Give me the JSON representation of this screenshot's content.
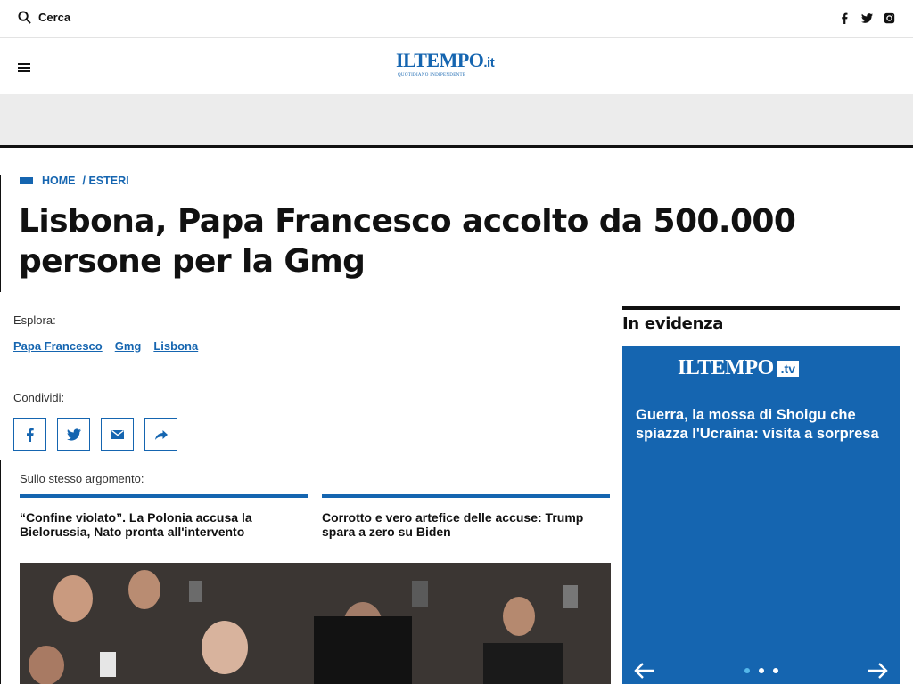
{
  "topbar": {
    "search_label": "Cerca",
    "social": [
      "facebook-icon",
      "twitter-icon",
      "instagram-icon"
    ]
  },
  "header": {
    "logo_main": "ILTEMPO",
    "logo_suffix": ".it",
    "logo_tagline": "Quotidiano Indipendente"
  },
  "breadcrumb": {
    "home": "HOME",
    "section": "/ ESTERI"
  },
  "article": {
    "title": "Lisbona, Papa Francesco accolto da 500.000 persone per la Gmg"
  },
  "explore": {
    "label": "Esplora:",
    "tags": [
      "Papa Francesco",
      "Gmg",
      "Lisbona"
    ]
  },
  "share": {
    "label": "Condividi:",
    "buttons": [
      "facebook-icon",
      "twitter-icon",
      "mail-icon",
      "share-arrow-icon"
    ]
  },
  "related": {
    "label": "Sullo stesso argomento:",
    "items": [
      {
        "title": "“Confine violato”. La Polonia accusa la Bielorussia, Nato pronta all'intervento"
      },
      {
        "title": "Corrotto e vero artefice delle accuse: Trump spara a zero su Biden"
      }
    ]
  },
  "sidebar": {
    "title": "In evidenza",
    "tv_logo_main": "ILTEMPO",
    "tv_logo_suffix": ".tv",
    "headline": "Guerra, la mossa di Shoigu che spiazza l'Ucraina: visita a sorpresa",
    "slide_count": 3,
    "active_slide": 1
  },
  "colors": {
    "brand": "#1565b0",
    "text": "#111111",
    "ad_band": "#ececec",
    "active_dot": "#55b7ea"
  }
}
